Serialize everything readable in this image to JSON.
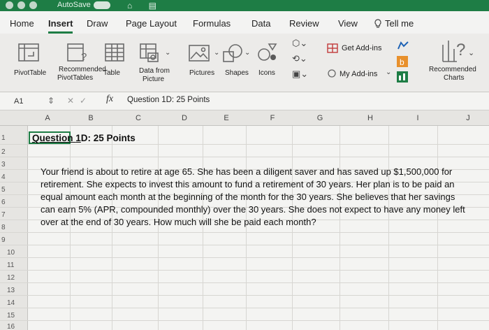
{
  "titlebar": {
    "autosave_label": "AutoSave",
    "autosave_state": "OFF",
    "accent_color": "#1e7d45"
  },
  "tabs": [
    {
      "label": "Home"
    },
    {
      "label": "Insert"
    },
    {
      "label": "Draw"
    },
    {
      "label": "Page Layout"
    },
    {
      "label": "Formulas"
    },
    {
      "label": "Data"
    },
    {
      "label": "Review"
    },
    {
      "label": "View"
    }
  ],
  "active_tab": "Insert",
  "tell_me": "Tell me",
  "ribbon": {
    "pivottable": "PivotTable",
    "recommended_pivottables": [
      "Recommended",
      "PivotTables"
    ],
    "table": "Table",
    "data_from_picture": [
      "Data from",
      "Picture"
    ],
    "pictures": "Pictures",
    "shapes": "Shapes",
    "icons": "Icons",
    "get_addins": "Get Add-ins",
    "my_addins": "My Add-ins",
    "recommended_charts": [
      "Recommended",
      "Charts"
    ]
  },
  "formula_bar": {
    "name_box": "A1",
    "fx": "fx",
    "content": "Question 1D: 25 Points"
  },
  "columns": [
    "A",
    "B",
    "C",
    "D",
    "E",
    "F",
    "G",
    "H",
    "I",
    "J"
  ],
  "rows": [
    "1",
    "2",
    "3",
    "4",
    "5",
    "6",
    "7",
    "8",
    "9",
    "10",
    "11",
    "12",
    "13",
    "14",
    "15",
    "16"
  ],
  "sheet": {
    "title_prefix": "Question ",
    "title_cell_part": "1",
    "title_rest": "D: 25 Points",
    "paragraph": [
      "Your friend is about to retire at age 65. She has been a diligent saver and has saved up $1,500,000 for",
      "retirement. She expects to invest this amount to fund a retirement of 30 years. Her plan is to be paid an",
      "equal amount each month at the beginning of the month for the 30 years. She believes that her savings",
      "can earn 5% (APR, compounded monthly) over the 30 years. She does not expect to have any money left",
      "over at the end of 30 years. How much will she be paid each month?"
    ]
  }
}
